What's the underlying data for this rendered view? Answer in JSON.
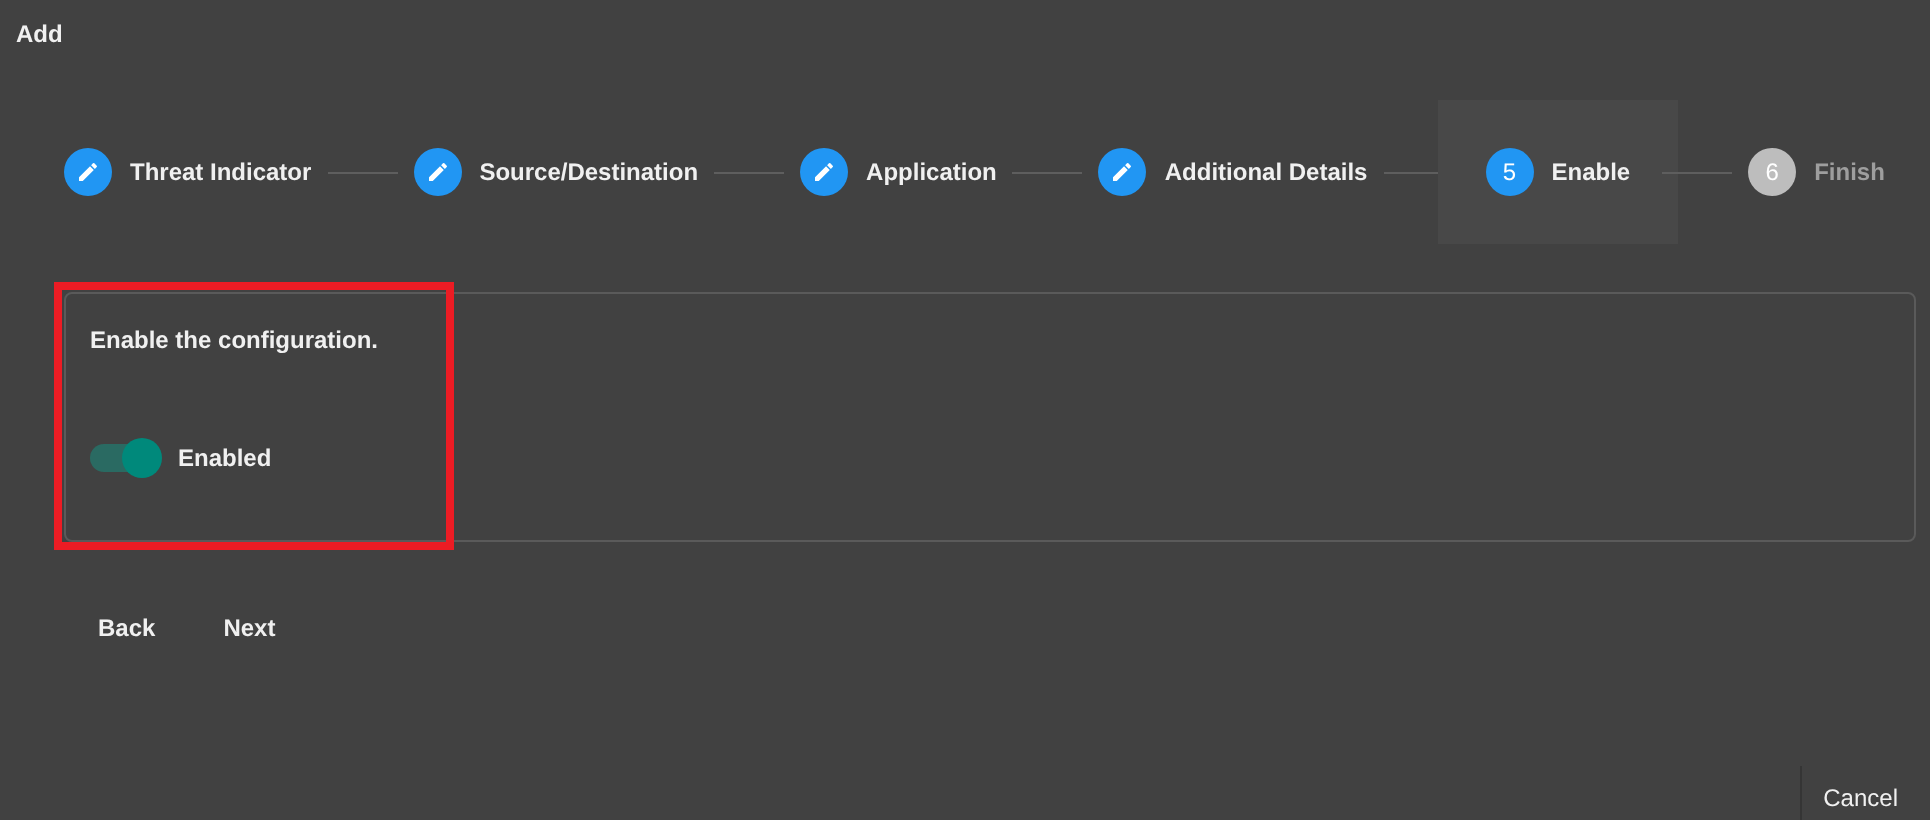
{
  "window": {
    "title": "Add"
  },
  "steps": [
    {
      "label": "Threat Indicator",
      "kind": "done"
    },
    {
      "label": "Source/Destination",
      "kind": "done"
    },
    {
      "label": "Application",
      "kind": "done"
    },
    {
      "label": "Additional Details",
      "kind": "done"
    },
    {
      "label": "Enable",
      "kind": "current",
      "number": "5"
    },
    {
      "label": "Finish",
      "kind": "pending",
      "number": "6"
    }
  ],
  "panel": {
    "text": "Enable the configuration.",
    "highlighted": true,
    "toggle": {
      "label": "Enabled",
      "on": true
    }
  },
  "buttons": [
    "Back",
    "Next"
  ],
  "footer": {
    "button": "Cancel"
  }
}
